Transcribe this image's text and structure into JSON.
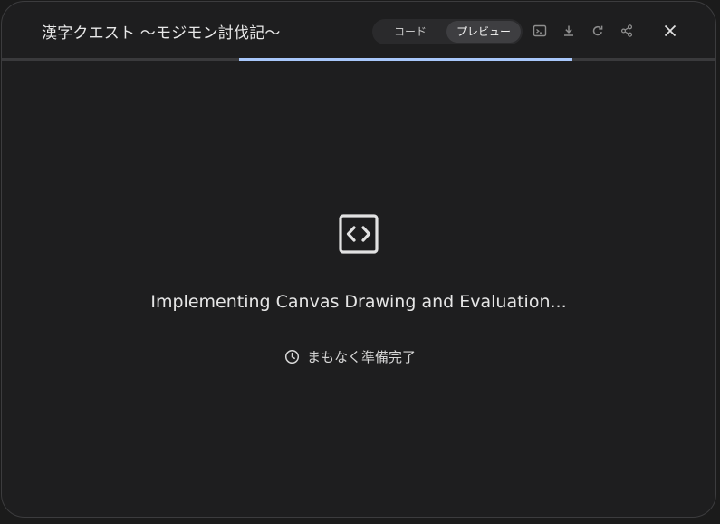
{
  "header": {
    "title": "漢字クエスト 〜モジモン討伐記〜",
    "toggle": {
      "code_label": "コード",
      "preview_label": "プレビュー",
      "selected": "preview"
    },
    "icons": [
      "terminal-icon",
      "download-icon",
      "refresh-icon",
      "share-icon",
      "close-icon"
    ]
  },
  "progress": {
    "start": 0.333,
    "fill": 0.467,
    "color": "#a8c7fa"
  },
  "loading": {
    "icon": "code-brackets-icon",
    "title": "Implementing Canvas Drawing and Evaluation...",
    "status_icon": "clock-icon",
    "status": "まもなく準備完了"
  }
}
